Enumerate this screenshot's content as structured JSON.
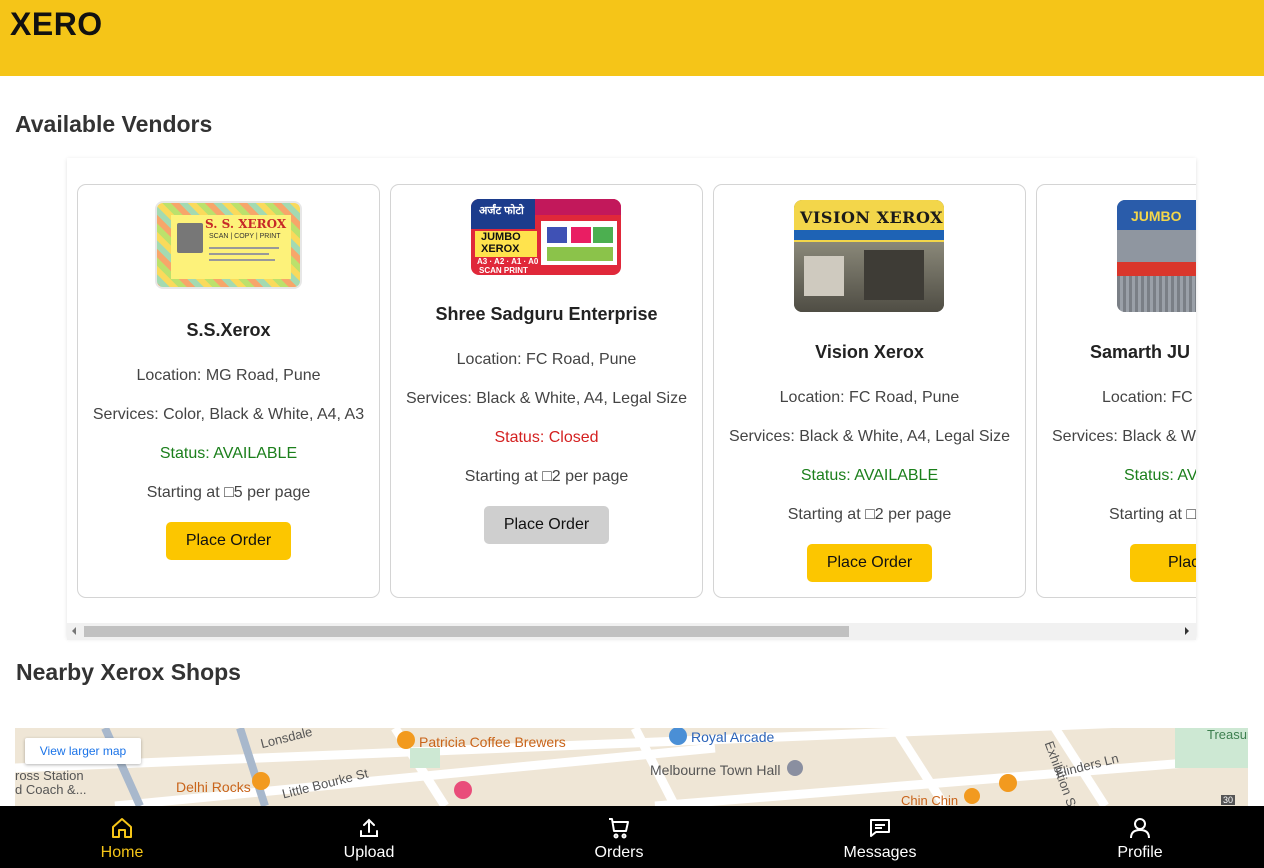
{
  "header": {
    "title": "XERO"
  },
  "vendors_section": {
    "title": "Available Vendors"
  },
  "vendors": [
    {
      "name": "S.S.Xerox",
      "image_text": [
        "S. S. XEROX",
        "SCAN | COPY | PRINT"
      ],
      "location": "Location: MG Road, Pune",
      "services": "Services: Color, Black & White, A4, A3",
      "status": "Status: AVAILABLE",
      "price": "Starting at □5 per page",
      "button": "Place Order"
    },
    {
      "name": "Shree Sadguru Enterprise",
      "image_text": [
        "अर्जंट फोटो",
        "JUMBO",
        "XEROX",
        "A3 · A2 · A1 · A0",
        "SCAN PRINT"
      ],
      "location": "Location: FC Road, Pune",
      "services": "Services: Black & White, A4, Legal Size",
      "status": "Status: Closed",
      "price": "Starting at □2 per page",
      "button": "Place Order"
    },
    {
      "name": "Vision Xerox",
      "image_text": [
        "VISION XEROX"
      ],
      "location": "Location: FC Road, Pune",
      "services": "Services: Black & White, A4, Legal Size",
      "status": "Status: AVAILABLE",
      "price": "Starting at □2 per page",
      "button": "Place Order"
    },
    {
      "name": "Samarth JU",
      "image_text": [
        "JUMBO"
      ],
      "location": "Location: FC",
      "services": "Services: Black & W",
      "status": "Status: AV",
      "price": "Starting at □",
      "button": "Place"
    }
  ],
  "nearby_section": {
    "title": "Nearby Xerox Shops"
  },
  "map": {
    "view_larger": "View larger map",
    "labels": [
      "Lonsdale",
      "Patricia Coffee Brewers",
      "Royal Arcade",
      "Treasury Gardens",
      "ross Station",
      "d Coach &...",
      "Delhi Rocks",
      "Little Bourke St",
      "Melbourne Town Hall",
      "Exhibition St",
      "Flinders Ln",
      "Chin Chin",
      "30"
    ]
  },
  "nav": [
    {
      "label": "Home",
      "icon": "home-icon",
      "active": true
    },
    {
      "label": "Upload",
      "icon": "upload-icon",
      "active": false
    },
    {
      "label": "Orders",
      "icon": "cart-icon",
      "active": false
    },
    {
      "label": "Messages",
      "icon": "message-icon",
      "active": false
    },
    {
      "label": "Profile",
      "icon": "profile-icon",
      "active": false
    }
  ],
  "colors": {
    "header": "#f5c518",
    "button": "#fcc600",
    "available": "#1b7f1b",
    "closed": "#d42020",
    "nav_bg": "#000000",
    "nav_active": "#f5c518"
  }
}
